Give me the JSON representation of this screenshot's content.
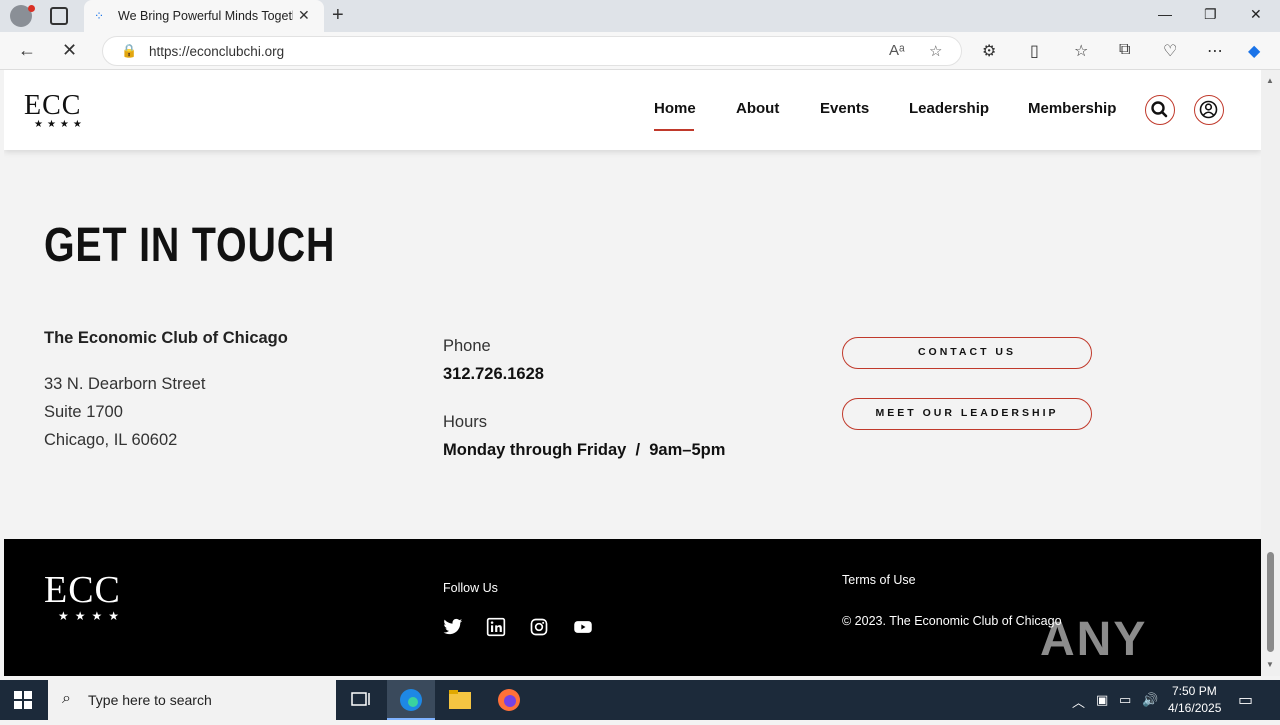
{
  "browser": {
    "tab_title": "We Bring Powerful Minds Togeth",
    "url": "https://econclubchi.org",
    "new_tab": "+",
    "close_tab": "✕",
    "minimize": "—",
    "restore": "❐",
    "close_window": "✕"
  },
  "site": {
    "logo": "ECC",
    "logo_stars": "★★★★",
    "nav": [
      "Home",
      "About",
      "Events",
      "Leadership",
      "Membership"
    ],
    "active_nav": "Home",
    "accent_color": "#c0392b"
  },
  "contact": {
    "title": "GET IN TOUCH",
    "org": "The Economic Club of Chicago",
    "address": [
      "33 N. Dearborn Street",
      "Suite 1700",
      "Chicago, IL 60602"
    ],
    "phone_label": "Phone",
    "phone": "312.726.1628",
    "hours_label": "Hours",
    "hours": "Monday through Friday  /  9am–5pm",
    "contact_button": "CONTACT US",
    "leadership_button": "MEET OUR LEADERSHIP"
  },
  "footer": {
    "logo": "ECC",
    "logo_stars": "★★★★",
    "follow": "Follow Us",
    "terms": "Terms of Use",
    "copyright": "© 2023. The Economic Club of Chicago",
    "watermark": "ANY RUN"
  },
  "taskbar": {
    "search_placeholder": "Type here to search",
    "time": "7:50 PM",
    "date": "4/16/2025"
  }
}
